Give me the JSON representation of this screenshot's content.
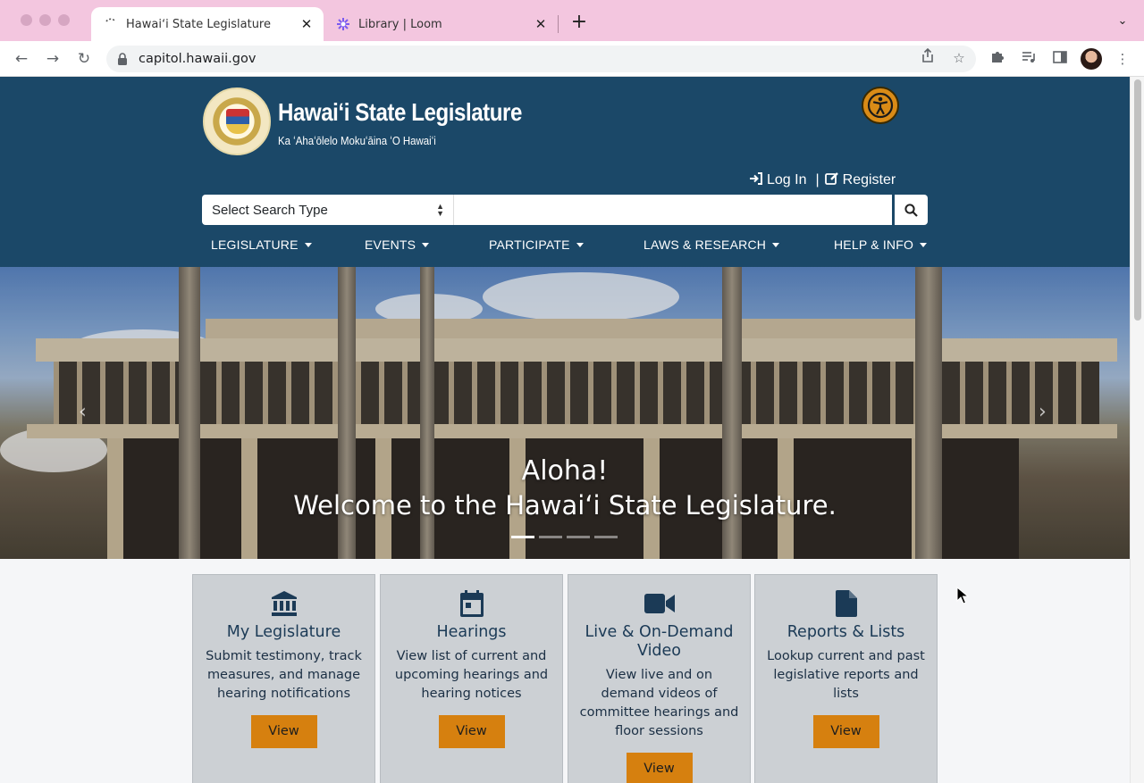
{
  "browser": {
    "tabs": [
      {
        "title": "Hawaiʻi State Legislature",
        "active": true
      },
      {
        "title": "Library | Loom",
        "active": false
      }
    ],
    "url": "capitol.hawaii.gov"
  },
  "header": {
    "title": "Hawaiʻi State Legislature",
    "subtitle": "Ka ʻAhaʻōlelo Mokuʻāina ʻO Hawaiʻi",
    "login_label": "Log In",
    "register_label": "Register",
    "separator": "|"
  },
  "search": {
    "select_value": "Select Search Type",
    "input_value": ""
  },
  "nav": {
    "items": [
      {
        "label": "LEGISLATURE"
      },
      {
        "label": "EVENTS"
      },
      {
        "label": "PARTICIPATE"
      },
      {
        "label": "LAWS & RESEARCH"
      },
      {
        "label": "HELP & INFO"
      }
    ]
  },
  "hero": {
    "line1": "Aloha!",
    "line2": "Welcome to the Hawaiʻi State Legislature.",
    "slides": 4,
    "active_slide": 1
  },
  "cards": [
    {
      "title": "My Legislature",
      "description": "Submit testimony, track measures, and manage hearing notifications",
      "button": "View",
      "icon": "building-icon"
    },
    {
      "title": "Hearings",
      "description": "View list of current and upcoming hearings and hearing notices",
      "button": "View",
      "icon": "calendar-icon"
    },
    {
      "title": "Live & On-Demand Video",
      "description": "View live and on demand videos of committee hearings and floor sessions",
      "button": "View",
      "icon": "video-camera-icon"
    },
    {
      "title": "Reports & Lists",
      "description": "Lookup current and past legislative reports and lists",
      "button": "View",
      "icon": "document-icon"
    }
  ],
  "colors": {
    "header_bg": "#1b4868",
    "accent_orange": "#d6800f",
    "card_bg": "#ccd0d4",
    "tabbar_bg": "#f3c6df"
  }
}
